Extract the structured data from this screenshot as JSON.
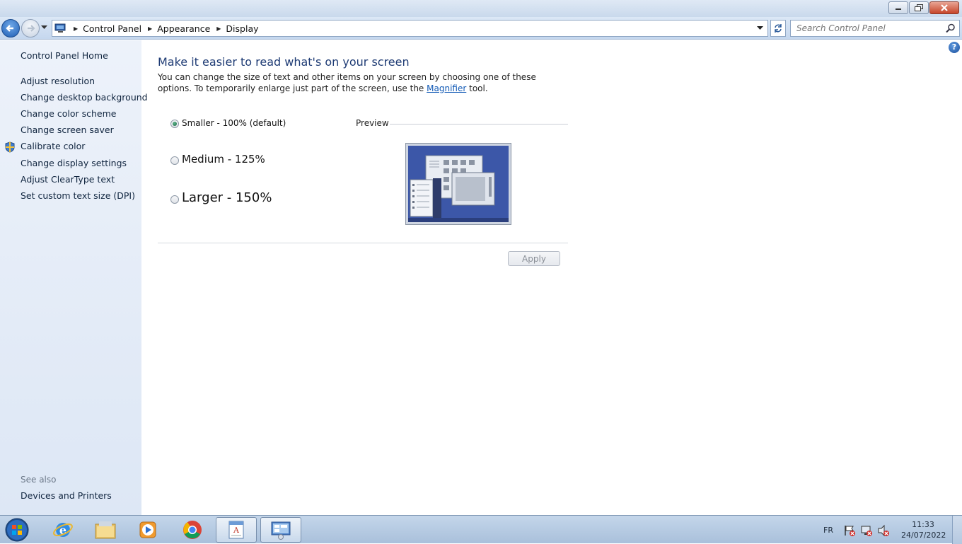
{
  "window": {
    "controls": [
      "minimize-icon",
      "restore-icon",
      "close-icon"
    ]
  },
  "address_bar": {
    "breadcrumbs": [
      "Control Panel",
      "Appearance",
      "Display"
    ],
    "search_placeholder": "Search Control Panel"
  },
  "sidebar": {
    "home": "Control Panel Home",
    "links": [
      "Adjust resolution",
      "Change desktop background",
      "Change color scheme",
      "Change screen saver",
      "Calibrate color",
      "Change display settings",
      "Adjust ClearType text",
      "Set custom text size (DPI)"
    ],
    "see_also_heading": "See also",
    "see_also_links": [
      "Devices and Printers"
    ]
  },
  "main": {
    "title": "Make it easier to read what's on your screen",
    "description_part1": "You can change the size of text and other items on your screen by choosing one of these options. To temporarily enlarge just part of the screen, use the",
    "description_link": "Magnifier",
    "description_part2": "tool.",
    "options": [
      {
        "label": "Smaller - 100% (default)",
        "checked": true
      },
      {
        "label": "Medium - 125%",
        "checked": false
      },
      {
        "label": "Larger - 150%",
        "checked": false
      }
    ],
    "preview_label": "Preview",
    "apply_label": "Apply"
  },
  "taskbar": {
    "apps": [
      "start-orb",
      "internet-explorer-icon",
      "windows-explorer-icon",
      "media-player-icon",
      "chrome-icon",
      "wordpad-icon",
      "control-panel-icon"
    ],
    "language": "FR",
    "time": "11:33",
    "date": "24/07/2022"
  }
}
